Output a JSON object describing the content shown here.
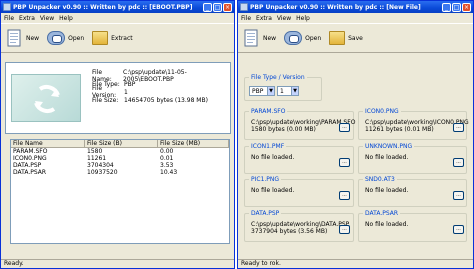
{
  "left": {
    "title": "PBP Unpacker v0.90 :: Written by pdc :: [EBOOT.PBP]",
    "menu": [
      "File",
      "Extra",
      "View",
      "Help"
    ],
    "toolbar": [
      {
        "label": "New",
        "icon": "new-document-icon"
      },
      {
        "label": "Open",
        "icon": "open-icon"
      },
      {
        "label": "Extract",
        "icon": "extract-folder-icon"
      }
    ],
    "file_info": [
      {
        "key": "File Name:",
        "value": "C:\\psp\\update\\11-05-2005\\EBOOT.PBP"
      },
      {
        "key": "File Type:",
        "value": "PBP"
      },
      {
        "key": "File Version:",
        "value": "1"
      },
      {
        "key": "File Size:",
        "value": "14654705 bytes (13.98 MB)"
      }
    ],
    "table": {
      "columns": [
        "File Name",
        "File Size (B)",
        "File Size (MB)"
      ],
      "rows": [
        [
          "PARAM.SFO",
          "1580",
          "0.00"
        ],
        [
          "ICON0.PNG",
          "11261",
          "0.01"
        ],
        [
          "DATA.PSP",
          "3704304",
          "3.53"
        ],
        [
          "DATA.PSAR",
          "10937520",
          "10.43"
        ]
      ]
    },
    "status": "Ready."
  },
  "right": {
    "title": "PBP Unpacker v0.90 :: Written by pdc :: [New File]",
    "menu": [
      "File",
      "Extra",
      "View",
      "Help"
    ],
    "toolbar": [
      {
        "label": "New",
        "icon": "new-document-icon"
      },
      {
        "label": "Open",
        "icon": "open-icon"
      },
      {
        "label": "Save",
        "icon": "save-folder-icon"
      }
    ],
    "type_group": {
      "title": "File Type / Version",
      "type_value": "PBP",
      "version_value": "1"
    },
    "groups": [
      {
        "title": "PARAM.SFO",
        "line1": "C:\\psp\\update\\working\\PARAM.SFO",
        "line2": "1580 bytes (0.00 MB)"
      },
      {
        "title": "ICON0.PNG",
        "line1": "C:\\psp\\update\\working\\ICON0.PNG",
        "line2": "11261 bytes (0.01 MB)"
      },
      {
        "title": "ICON1.PMF",
        "line1": "No file loaded.",
        "line2": ""
      },
      {
        "title": "UNKNOWN.PNG",
        "line1": "No file loaded.",
        "line2": ""
      },
      {
        "title": "PIC1.PNG",
        "line1": "No file loaded.",
        "line2": ""
      },
      {
        "title": "SND0.AT3",
        "line1": "No file loaded.",
        "line2": ""
      },
      {
        "title": "DATA.PSP",
        "line1": "C:\\psp\\update\\working\\DATA.PSP",
        "line2": "3737904 bytes (3.56 MB)"
      },
      {
        "title": "DATA.PSAR",
        "line1": "No file loaded.",
        "line2": ""
      }
    ],
    "browse_label": "...",
    "status": "Ready to rok."
  }
}
